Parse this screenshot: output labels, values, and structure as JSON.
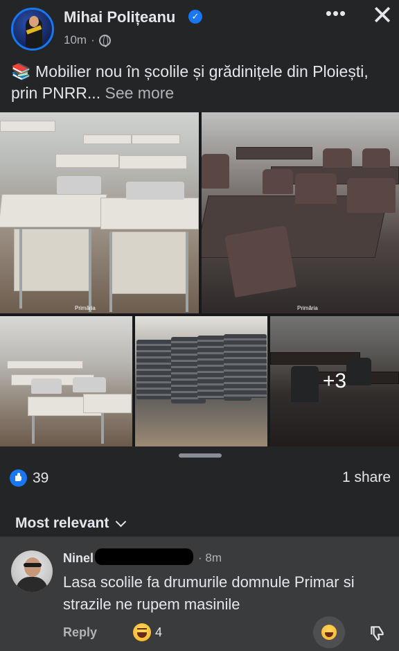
{
  "post": {
    "author": "Mihai Polițeanu",
    "verified_mark": "✓",
    "time": "10m",
    "separator": "·",
    "more_label": "•••",
    "close_label": "✕",
    "caption_icon": "books-emoji",
    "caption_emoji": "📚",
    "caption": "Mobilier nou în școlile și grădinițele din Ploiești, prin PNRR...",
    "see_more": "See more"
  },
  "photos": {
    "watermark": "Primăria",
    "more_count": "+3",
    "count_total": 8
  },
  "engagement": {
    "likes": "39",
    "shares": "1 share"
  },
  "comments": {
    "sort_label": "Most relevant",
    "items": [
      {
        "author": "Ninel",
        "time": "8m",
        "separator": "·",
        "text": "Lasa scolile fa drumurile domnule Primar si strazile ne rupem masinile",
        "reply_label": "Reply",
        "reaction_count": "4"
      }
    ]
  },
  "colors": {
    "background": "#242526",
    "comment_bg": "#3a3b3c",
    "accent": "#1877f2",
    "text_primary": "#e4e6eb",
    "text_secondary": "#b0b3b8"
  },
  "icons": [
    "globe-icon",
    "verified-badge-icon",
    "more-options-icon",
    "close-icon",
    "like-reaction-icon",
    "chevron-down-icon",
    "haha-reaction-icon",
    "react-button-icon",
    "dislike-icon"
  ]
}
